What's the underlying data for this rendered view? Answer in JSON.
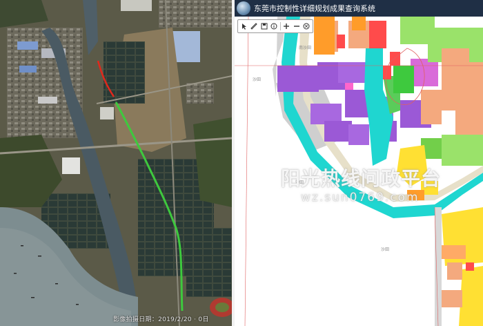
{
  "satellite_view": {
    "imagery_date_label": "影像拍摄日期：2019/2/20 · 0日"
  },
  "planning_map": {
    "app_title": "东莞市控制性详细规划成果查询系统",
    "toolbar": {
      "tools": [
        {
          "icon": "pointer-icon"
        },
        {
          "icon": "ruler-icon"
        },
        {
          "icon": "save-icon"
        },
        {
          "icon": "info-icon"
        },
        {
          "icon": "zoom-in-icon"
        },
        {
          "icon": "zoom-out-icon"
        },
        {
          "icon": "globe-icon"
        }
      ]
    },
    "place_labels": {
      "label_top": "南沙田",
      "label_left": "沙田",
      "label_middle": "沙田",
      "label_bottom": "沙田"
    },
    "watermark": {
      "title": "阳光热线问政平台",
      "url": "wz.sun0769.com"
    },
    "colors": {
      "residential": "#f4a97e",
      "commercial": "#ff4b4b",
      "industrial": "#9b59d6",
      "green_space": "#9ae26a",
      "water_teal": "#1fd6d0",
      "road_gray": "#c8c8c8",
      "yellow_zone": "#ffe033",
      "route_line": "#3ec93e"
    }
  }
}
